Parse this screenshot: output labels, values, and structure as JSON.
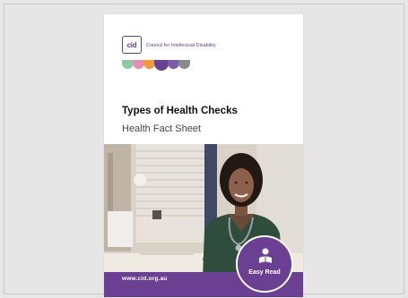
{
  "document": {
    "logo_mark": "cid",
    "org_name": "Council for Intellectual Disability",
    "title": "Types of Health Checks",
    "subtitle": "Health Fact Sheet",
    "footer_url": "www.cid.org.au",
    "badge_label": "Easy Read",
    "photo_subject": "smiling doctor with stethoscope"
  },
  "colors": {
    "brand_purple": "#6b3f91",
    "logo_dots": [
      "#8cc9a4",
      "#e58fb8",
      "#f29a3a",
      "#6b3f91",
      "#7b5ea8",
      "#8a8a8a"
    ]
  },
  "icons": [
    "reading-person-icon"
  ]
}
